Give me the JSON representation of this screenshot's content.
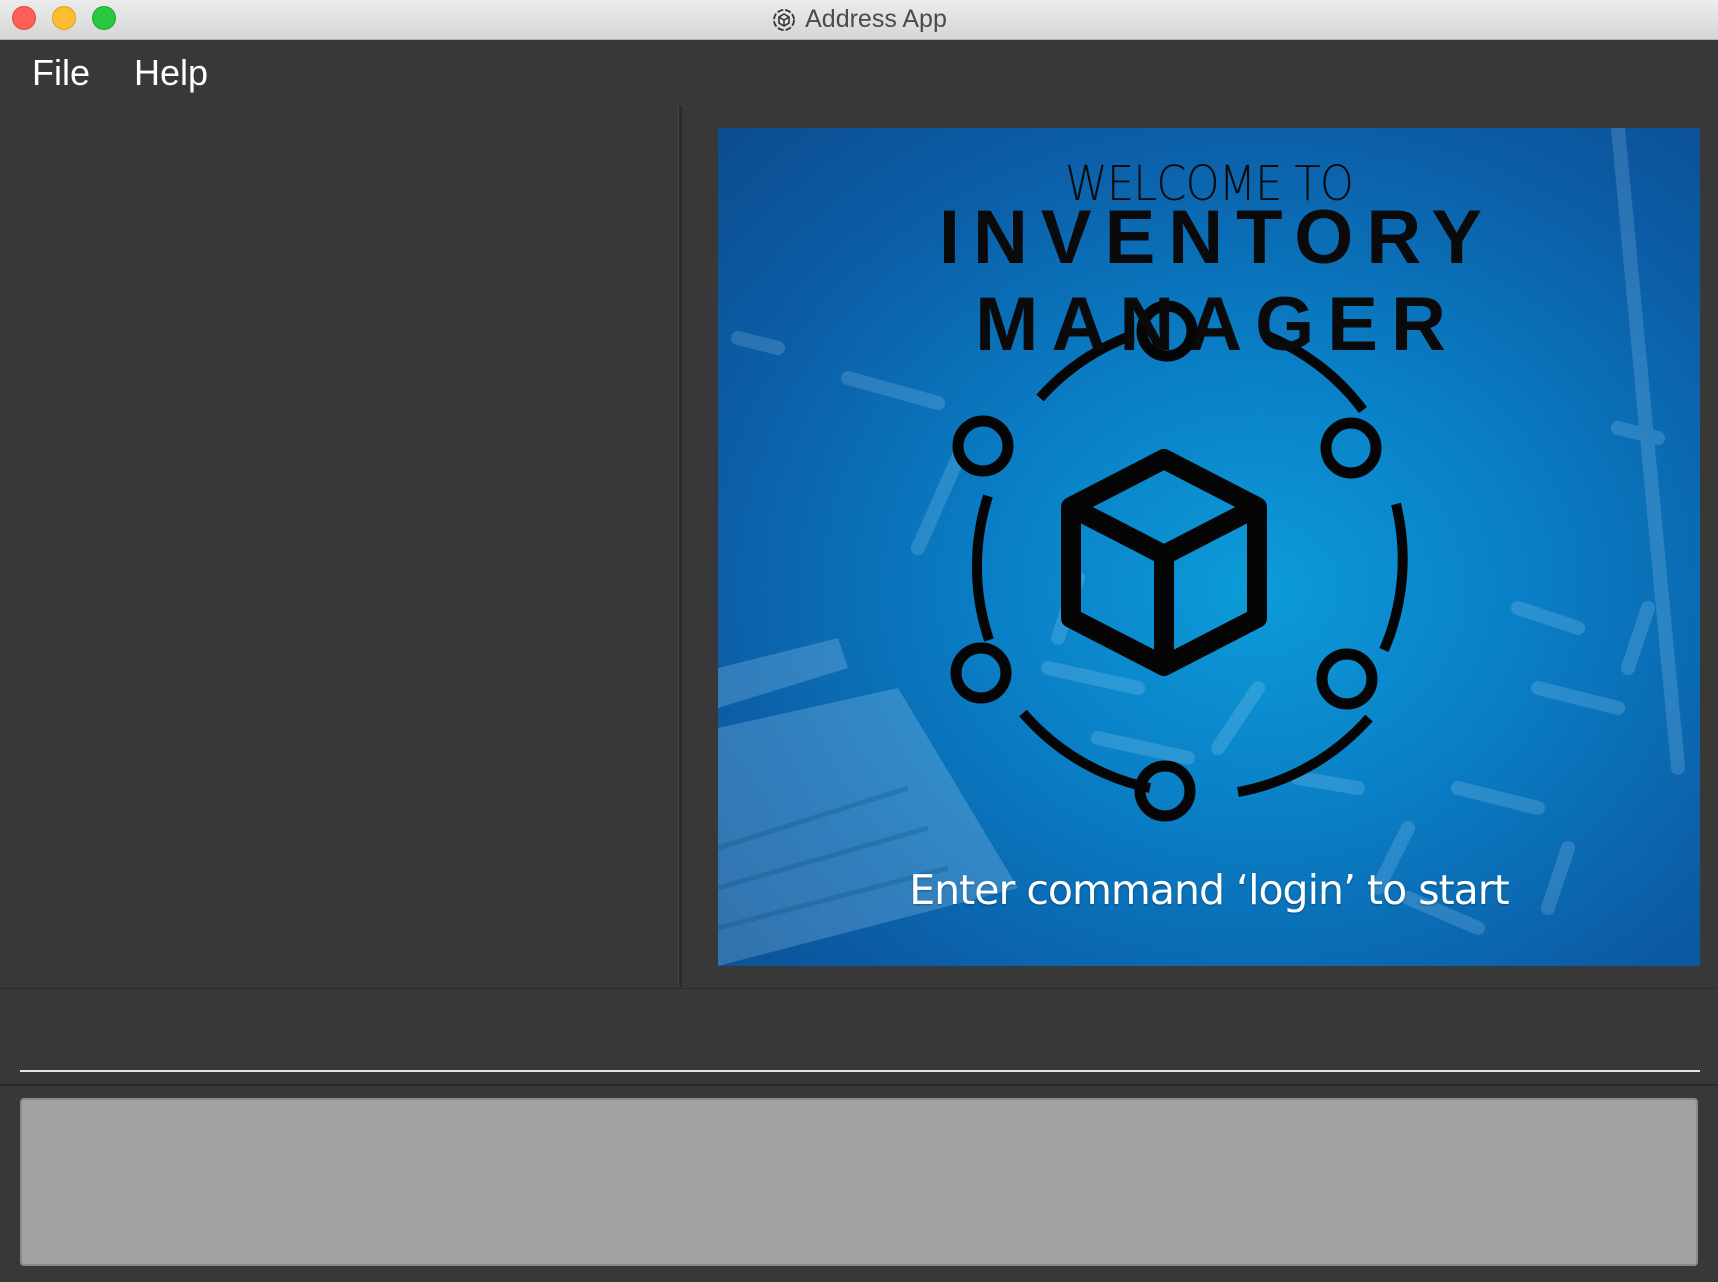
{
  "window": {
    "title": "Address App"
  },
  "menu": {
    "file_label": "File",
    "help_label": "Help"
  },
  "welcome": {
    "top_line": "WELCOME TO",
    "main_line": "INVENTORY MANAGER",
    "command_line": "Enter command ‘login’ to start"
  },
  "command_box": {
    "value": "",
    "placeholder": ""
  },
  "colors": {
    "background": "#383838",
    "welcome_blue": "#0a7fc6",
    "command_box": "#a2a2a2"
  },
  "icons": [
    "app-icon",
    "inventory-cube-icon"
  ]
}
